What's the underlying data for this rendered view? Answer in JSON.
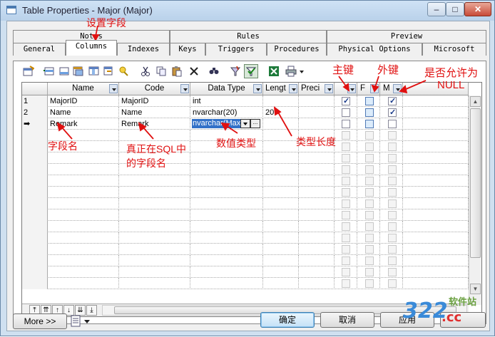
{
  "window": {
    "title": "Table Properties - Major (Major)",
    "buttons": {
      "minimize": "–",
      "maximize": "□",
      "close": "✕"
    }
  },
  "tabs": {
    "row1": [
      "Notes",
      "Rules",
      "Preview"
    ],
    "row2": [
      "General",
      "Columns",
      "Indexes",
      "Keys",
      "Triggers",
      "Procedures",
      "Physical Options",
      "Microsoft"
    ],
    "active": "Columns"
  },
  "toolbar": {
    "icons": [
      "properties-icon",
      "insert-row-icon",
      "add-row-icon",
      "add-columns-icon",
      "add-column-icon",
      "reuse-icon",
      "rules-icon",
      "cut-icon",
      "copy-icon",
      "paste-icon",
      "delete-icon",
      "find-icon",
      "filter-icon",
      "customize-columns-icon",
      "excel-icon",
      "print-icon"
    ]
  },
  "grid": {
    "columns": [
      "Name",
      "Code",
      "Data Type",
      "Lengt",
      "Preci",
      "",
      "F",
      "M"
    ],
    "rows": [
      {
        "num": "1",
        "name": "MajorID",
        "code": "MajorID",
        "type": "int",
        "length": "",
        "p": true,
        "f": false,
        "m": true
      },
      {
        "num": "2",
        "name": "Name",
        "code": "Name",
        "type": "nvarchar(20)",
        "length": "20",
        "p": false,
        "f": false,
        "m": true
      },
      {
        "num": "➡",
        "name": "Remark",
        "code": "Remark",
        "type": "nvarchar(Max)",
        "length": "",
        "p": false,
        "f": false,
        "m": false
      }
    ],
    "combo_more": "..."
  },
  "annotations": {
    "set_fields": "设置字段",
    "primary_key": "主键",
    "foreign_key": "外键",
    "allow_null_line1": "是否允许为",
    "allow_null_line2": "NULL",
    "field_name": "字段名",
    "sql_name_line1": "真正在SQL中",
    "sql_name_line2": "的字段名",
    "data_type": "数值类型",
    "type_length": "类型长度"
  },
  "buttons": {
    "more": "More >>",
    "ok": "确定",
    "cancel": "取消",
    "apply": "应用"
  },
  "watermark": {
    "text1": "322",
    "text2": ".cc",
    "text3": "软件站"
  }
}
